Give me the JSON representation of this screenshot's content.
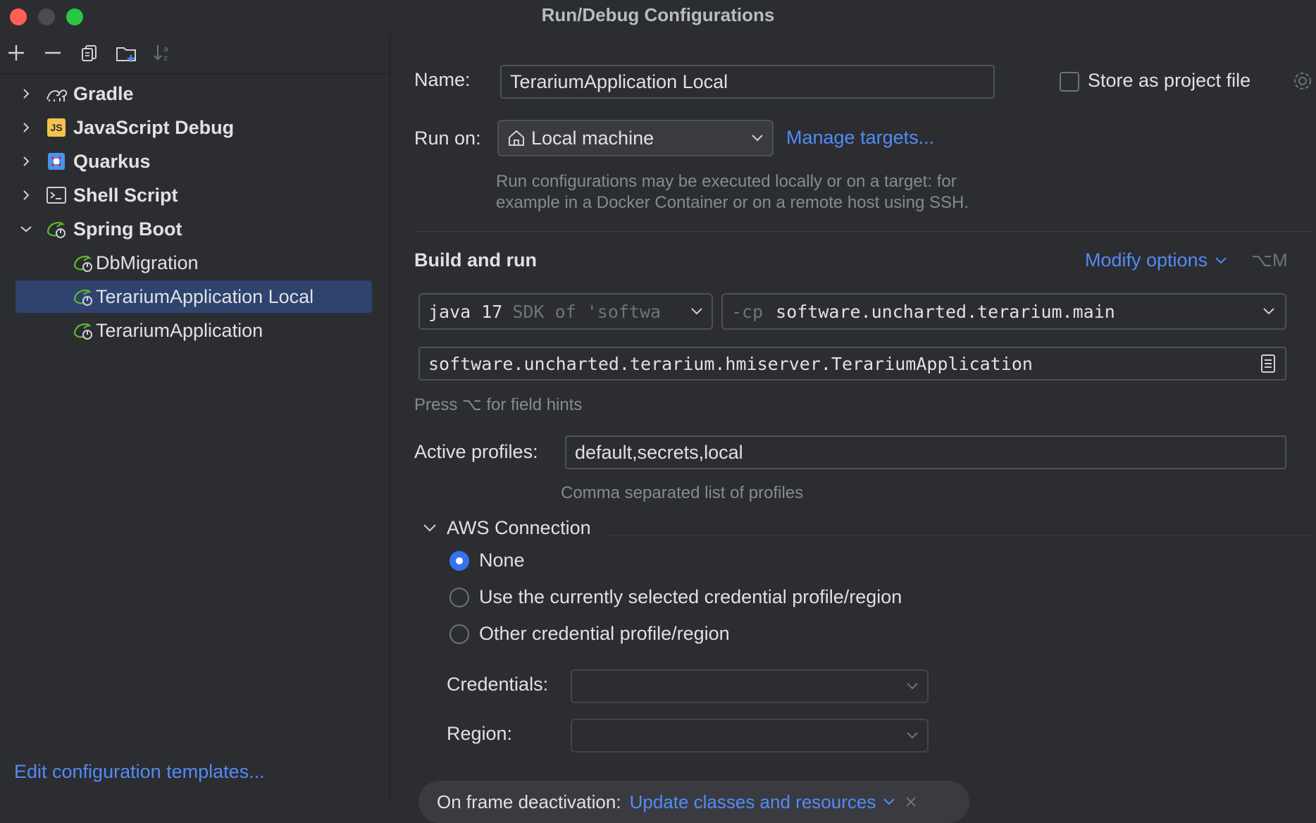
{
  "window": {
    "title": "Run/Debug Configurations"
  },
  "sidebar": {
    "items": [
      {
        "label": "Gradle",
        "icon": "gradle-icon",
        "expanded": false
      },
      {
        "label": "JavaScript Debug",
        "icon": "js-icon",
        "expanded": false
      },
      {
        "label": "Quarkus",
        "icon": "quarkus-icon",
        "expanded": false
      },
      {
        "label": "Shell Script",
        "icon": "terminal-icon",
        "expanded": false
      },
      {
        "label": "Spring Boot",
        "icon": "spring-boot-icon",
        "expanded": true
      }
    ],
    "children": [
      {
        "label": "DbMigration",
        "icon": "spring-boot-icon"
      },
      {
        "label": "TerariumApplication Local",
        "icon": "spring-boot-icon",
        "selected": true
      },
      {
        "label": "TerariumApplication",
        "icon": "spring-boot-icon"
      }
    ],
    "js_badge": "JS",
    "edit_templates": "Edit configuration templates..."
  },
  "form": {
    "name_label": "Name:",
    "name_value": "TerariumApplication Local",
    "store_label": "Store as project file",
    "run_on_label": "Run on:",
    "run_on_value": "Local machine",
    "manage_targets": "Manage targets...",
    "run_on_hint_1": "Run configurations may be executed locally or on a target: for",
    "run_on_hint_2": "example in a Docker Container or on a remote host using SSH.",
    "build_run_title": "Build and run",
    "modify_options": "Modify options",
    "modify_shortcut": "⌥M",
    "jdk_main": "java 17",
    "jdk_sub": "SDK of 'softwa",
    "cp_prefix": "-cp",
    "cp_value": "software.uncharted.terarium.main",
    "main_class": "software.uncharted.terarium.hmiserver.TerariumApplication",
    "field_hint": "Press ⌥ for field hints",
    "profiles_label": "Active profiles:",
    "profiles_value": "default,secrets,local",
    "profiles_hint": "Comma separated list of profiles",
    "aws_title": "AWS Connection",
    "aws_options": [
      "None",
      "Use the currently selected credential profile/region",
      "Other credential profile/region"
    ],
    "aws_selected": 0,
    "credentials_label": "Credentials:",
    "region_label": "Region:",
    "frame_label": "On frame deactivation:",
    "frame_value": "Update classes and resources"
  },
  "colors": {
    "accent": "#3574f0",
    "link": "#548af7",
    "selected_row": "#2e436e",
    "background": "#2b2d30"
  }
}
